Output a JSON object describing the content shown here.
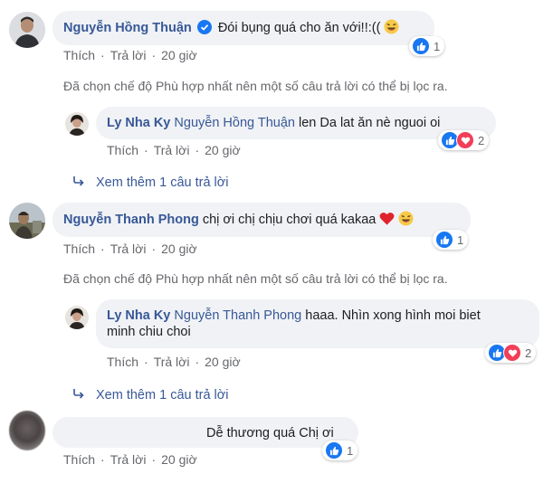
{
  "comments": [
    {
      "author": "Nguyễn Hồng Thuận",
      "text": "Đói bụng quá cho ăn với!!:((",
      "reaction_count": "1",
      "actions": {
        "like": "Thích",
        "reply": "Trả lời",
        "time": "20 giờ"
      },
      "filter_note": "Đã chọn chế độ Phù hợp nhất nên một số câu trả lời có thể bị lọc ra.",
      "reply": {
        "author": "Ly Nha Ky",
        "mention": "Nguyễn Hồng Thuận",
        "text": "len Da lat ăn nè nguoi oi",
        "reaction_count": "2",
        "actions": {
          "like": "Thích",
          "reply": "Trả lời",
          "time": "20 giờ"
        }
      },
      "more_replies": "Xem thêm 1 câu trả lời"
    },
    {
      "author": "Nguyễn Thanh Phong",
      "text": "chị ơi chị chịu chơi quá kakaa",
      "reaction_count": "1",
      "actions": {
        "like": "Thích",
        "reply": "Trả lời",
        "time": "20 giờ"
      },
      "filter_note": "Đã chọn chế độ Phù hợp nhất nên một số câu trả lời có thể bị lọc ra.",
      "reply": {
        "author": "Ly Nha Ky",
        "mention": "Nguyễn Thanh Phong",
        "text_line1": "haaa. Nhìn xong hình moi biet",
        "text_line2": "minh chiu choi",
        "reaction_count": "2",
        "actions": {
          "like": "Thích",
          "reply": "Trả lời",
          "time": "20 giờ"
        }
      },
      "more_replies": "Xem thêm 1 câu trả lời"
    },
    {
      "text": "Dễ thương quá Chị ơi",
      "reaction_count": "1",
      "actions": {
        "like": "Thích",
        "reply": "Trả lời",
        "time": "20 giờ"
      }
    }
  ],
  "colors": {
    "name": "#385898",
    "bubble": "#f0f2f5",
    "like": "#1877f2",
    "love": "#f33e58",
    "verified": "#1877f2",
    "muted": "#65676b"
  }
}
